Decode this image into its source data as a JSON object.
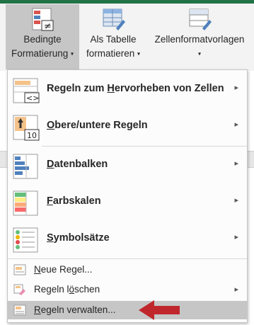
{
  "ribbon": {
    "conditional_formatting": {
      "line1": "Bedingte",
      "line2": "Formatierung",
      "caret": "▾"
    },
    "format_as_table": {
      "line1": "Als Tabelle",
      "line2": "formatieren",
      "caret": "▾"
    },
    "cell_styles": {
      "line1": "Zellenformatvorlagen",
      "caret": "▾"
    }
  },
  "menu": {
    "items": [
      {
        "pre": "Regeln zum ",
        "key": "H",
        "post": "ervorheben von Zellen",
        "submenu": "▸",
        "icon": "highlight-cells-icon"
      },
      {
        "pre": "",
        "key": "O",
        "post": "bere/untere Regeln",
        "submenu": "▸",
        "icon": "top-bottom-rules-icon",
        "icon_text": "10"
      },
      {
        "pre": "",
        "key": "D",
        "post": "atenbalken",
        "submenu": "▸",
        "icon": "data-bars-icon"
      },
      {
        "pre": "",
        "key": "F",
        "post": "arbskalen",
        "submenu": "▸",
        "icon": "color-scales-icon"
      },
      {
        "pre": "",
        "key": "S",
        "post": "ymbolsätze",
        "submenu": "▸",
        "icon": "icon-sets-icon"
      }
    ],
    "small_items": [
      {
        "pre": "",
        "key": "N",
        "post": "eue Regel...",
        "icon": "new-rule-icon"
      },
      {
        "pre": "Regeln l",
        "key": "ö",
        "post": "schen",
        "submenu": "▸",
        "icon": "clear-rules-icon"
      },
      {
        "pre": "",
        "key": "R",
        "post": "egeln verwalten...",
        "icon": "manage-rules-icon"
      }
    ]
  },
  "colors": {
    "accent": "#217346",
    "highlight": "#c6c6c6",
    "pointer": "#c0272d"
  }
}
